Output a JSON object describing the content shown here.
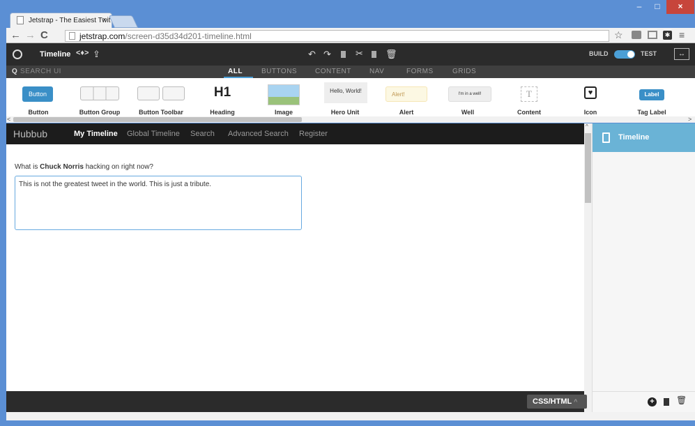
{
  "browser": {
    "tab_title": "Jetstrap - The Easiest Twit",
    "url_domain": "jetstrap.com",
    "url_path": "/screen-d35d34d201-timeline.html"
  },
  "toolbar": {
    "screen_name": "Timeline",
    "build_label": "BUILD",
    "test_label": "TEST"
  },
  "searchbar": {
    "placeholder": "SEARCH UI",
    "tabs": [
      "ALL",
      "BUTTONS",
      "CONTENT",
      "NAV",
      "FORMS",
      "GRIDS"
    ]
  },
  "components": [
    {
      "label": "Button",
      "preview": "Button"
    },
    {
      "label": "Button Group",
      "preview": ""
    },
    {
      "label": "Button Toolbar",
      "preview": ""
    },
    {
      "label": "Heading",
      "preview": "H1"
    },
    {
      "label": "Image",
      "preview": ""
    },
    {
      "label": "Hero Unit",
      "preview": "Hello, World!"
    },
    {
      "label": "Alert",
      "preview": "Alert!"
    },
    {
      "label": "Well",
      "preview": "I'm in a well!"
    },
    {
      "label": "Content",
      "preview": "T"
    },
    {
      "label": "Icon",
      "preview": ""
    },
    {
      "label": "Tag Label",
      "preview": "Label"
    }
  ],
  "hubbub": {
    "brand": "Hubbub",
    "nav": [
      "My Timeline",
      "Global Timeline",
      "Search",
      "Advanced Search",
      "Register"
    ],
    "prompt_pre": "What is ",
    "prompt_name": "Chuck Norris",
    "prompt_post": " hacking on right now?",
    "tweet_value": "This is not the greatest tweet in the world. This is just a tribute."
  },
  "footer": {
    "css_html_label": "CSS/HTML"
  },
  "right_panel": {
    "title": "Timeline"
  },
  "colors": {
    "accent": "#4b9fd6",
    "panel_header": "#6ab3d6",
    "chrome": "#5b8fd4"
  }
}
